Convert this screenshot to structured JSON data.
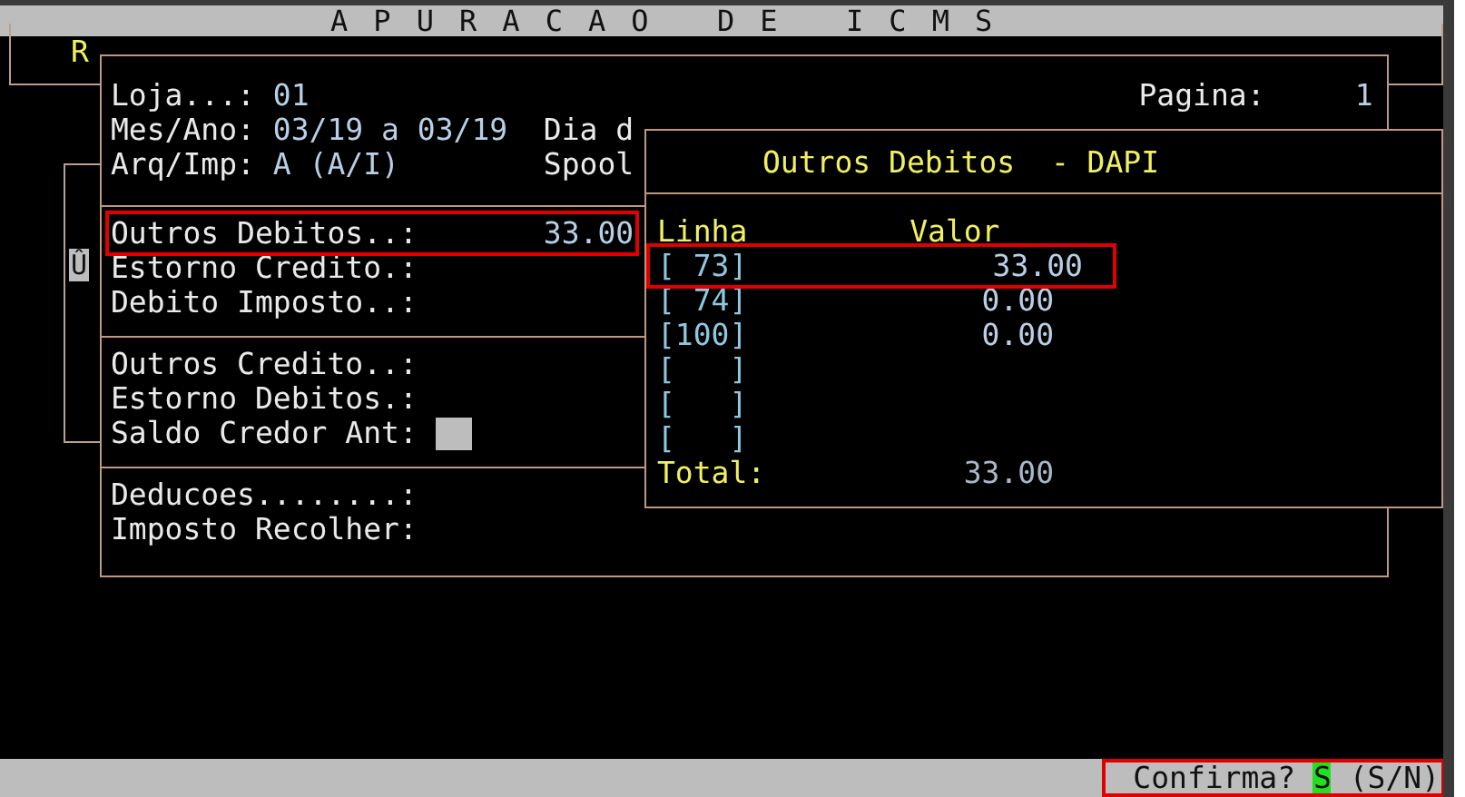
{
  "title_bar": {
    "title": "A P U R A C A O   D E   I C M S"
  },
  "background_window": {
    "label": "R",
    "scroll_marker": "Û"
  },
  "header": {
    "loja_label": "Loja...:",
    "loja": "01",
    "pagina_label": "Pagina:",
    "pagina": "1",
    "mes_ano_label": "Mes/Ano:",
    "mes_ano": "03/19 a 03/19",
    "dia_label": "Dia d",
    "arq_imp_label": "Arq/Imp:",
    "arq_imp": "A (A/I)",
    "spool_label": "Spool"
  },
  "sections": [
    {
      "rows": [
        {
          "kind": "text",
          "label": "Outros Debitos..:",
          "value": "33.00",
          "highlighted": true
        },
        {
          "kind": "text",
          "label": "Estorno Credito.:",
          "highlighted": false
        },
        {
          "kind": "text",
          "label": "Debito Imposto..:",
          "highlighted": false
        }
      ]
    },
    {
      "rows": [
        {
          "kind": "text",
          "label": "Outros Credito..:",
          "highlighted": false
        },
        {
          "kind": "text",
          "label": "Estorno Debitos.:",
          "highlighted": false
        },
        {
          "kind": "input",
          "label": "Saldo Credor Ant:",
          "highlighted": false
        }
      ]
    },
    {
      "rows": [
        {
          "kind": "text",
          "label": "Deducoes........:",
          "highlighted": false
        },
        {
          "kind": "text",
          "label": "Imposto Recolher:",
          "highlighted": false
        }
      ]
    }
  ],
  "popup": {
    "title": "Outros Debitos  - DAPI",
    "columns": [
      "Linha",
      "Valor"
    ],
    "rows": [
      {
        "line": "[ 73]",
        "value": "33.00",
        "highlighted": true
      },
      {
        "line": "[ 74]",
        "value": "0.00",
        "highlighted": false
      },
      {
        "line": "[100]",
        "value": "0.00",
        "highlighted": false
      },
      {
        "line": "[   ]",
        "highlighted": false
      },
      {
        "line": "[   ]",
        "highlighted": false
      },
      {
        "line": "[   ]",
        "highlighted": false
      }
    ],
    "total_label": "Total:",
    "total": "33.00"
  },
  "status_bar": {
    "prompt": "Confirma?",
    "answer": "S",
    "options": "(S/N)",
    "highlighted": true
  }
}
